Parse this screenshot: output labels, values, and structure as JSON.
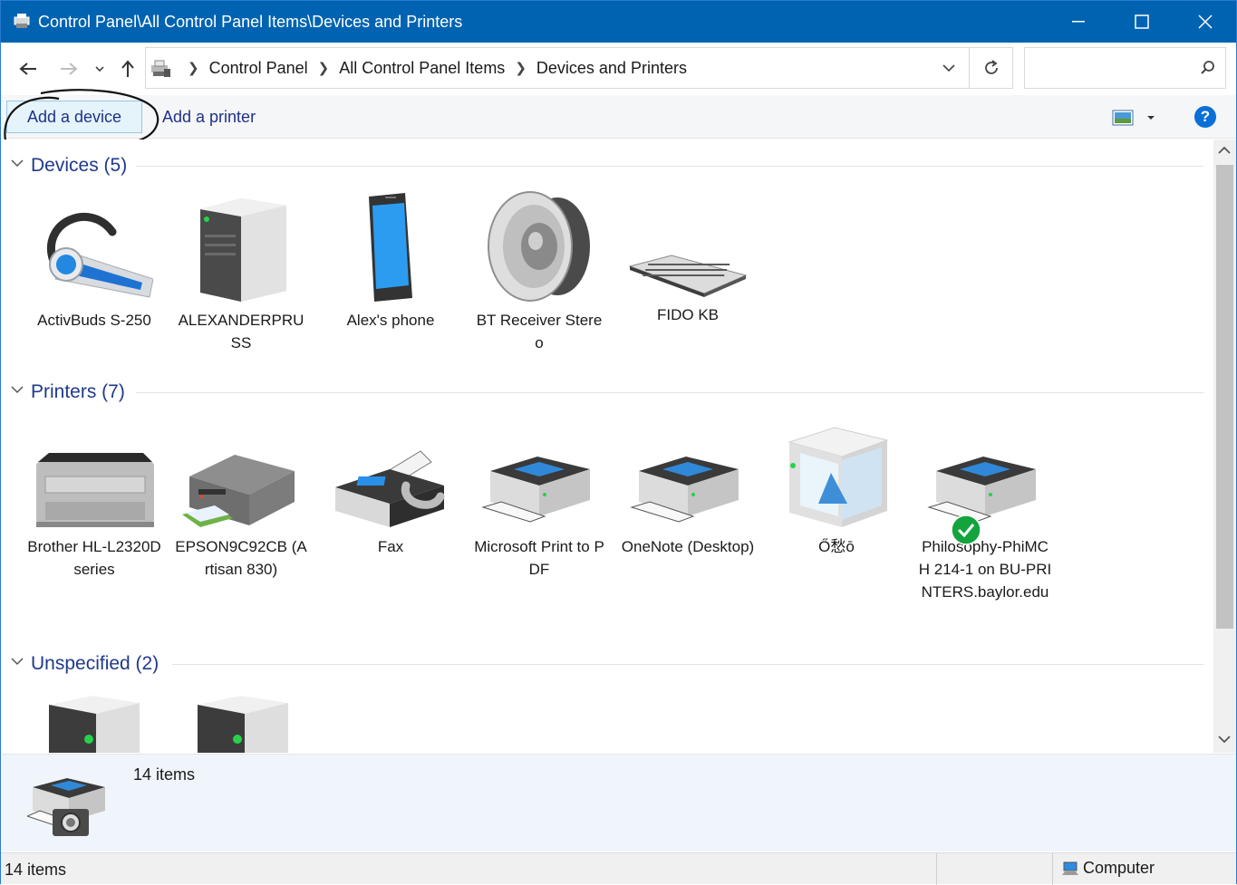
{
  "window": {
    "title": "Control Panel\\All Control Panel Items\\Devices and Printers"
  },
  "address": {
    "crumbs": [
      "Control Panel",
      "All Control Panel Items",
      "Devices and Printers"
    ],
    "search_placeholder": ""
  },
  "commands": {
    "add_device": "Add a device",
    "add_printer": "Add a printer"
  },
  "groups": {
    "devices": {
      "title": "Devices (5)",
      "items": [
        {
          "label": "ActivBuds S-250",
          "icon": "headset-icon"
        },
        {
          "label": "ALEXANDERPRUSS",
          "icon": "computer-tower-icon"
        },
        {
          "label": "Alex's phone",
          "icon": "phone-icon"
        },
        {
          "label": "BT Receiver Stereo",
          "icon": "speaker-icon"
        },
        {
          "label": "FIDO KB",
          "icon": "keyboard-icon"
        }
      ]
    },
    "printers": {
      "title": "Printers (7)",
      "items": [
        {
          "label": "Brother HL-L2320D series",
          "icon": "laser-printer-icon"
        },
        {
          "label": "EPSON9C92CB (Artisan 830)",
          "icon": "inkjet-printer-icon"
        },
        {
          "label": "Fax",
          "icon": "fax-icon"
        },
        {
          "label": "Microsoft Print to PDF",
          "icon": "printer-icon"
        },
        {
          "label": "OneNote (Desktop)",
          "icon": "printer-icon"
        },
        {
          "label": "Ő愁ō",
          "icon": "3d-printer-icon"
        },
        {
          "label": "Philosophy-PhiMCH 214-1 on BU-PRINTERS.baylor.edu",
          "icon": "default-printer-icon"
        }
      ]
    },
    "unspecified": {
      "title": "Unspecified (2)",
      "items": [
        {
          "label": "",
          "icon": "device-box-icon"
        },
        {
          "label": "",
          "icon": "device-box-icon"
        }
      ]
    }
  },
  "details": {
    "count": "14 items"
  },
  "status": {
    "left": "14 items",
    "right": "Computer"
  },
  "colors": {
    "titlebar": "#0063b1",
    "link": "#1e3287",
    "group_title": "#1e3a8a",
    "default_check": "#14a33d"
  }
}
